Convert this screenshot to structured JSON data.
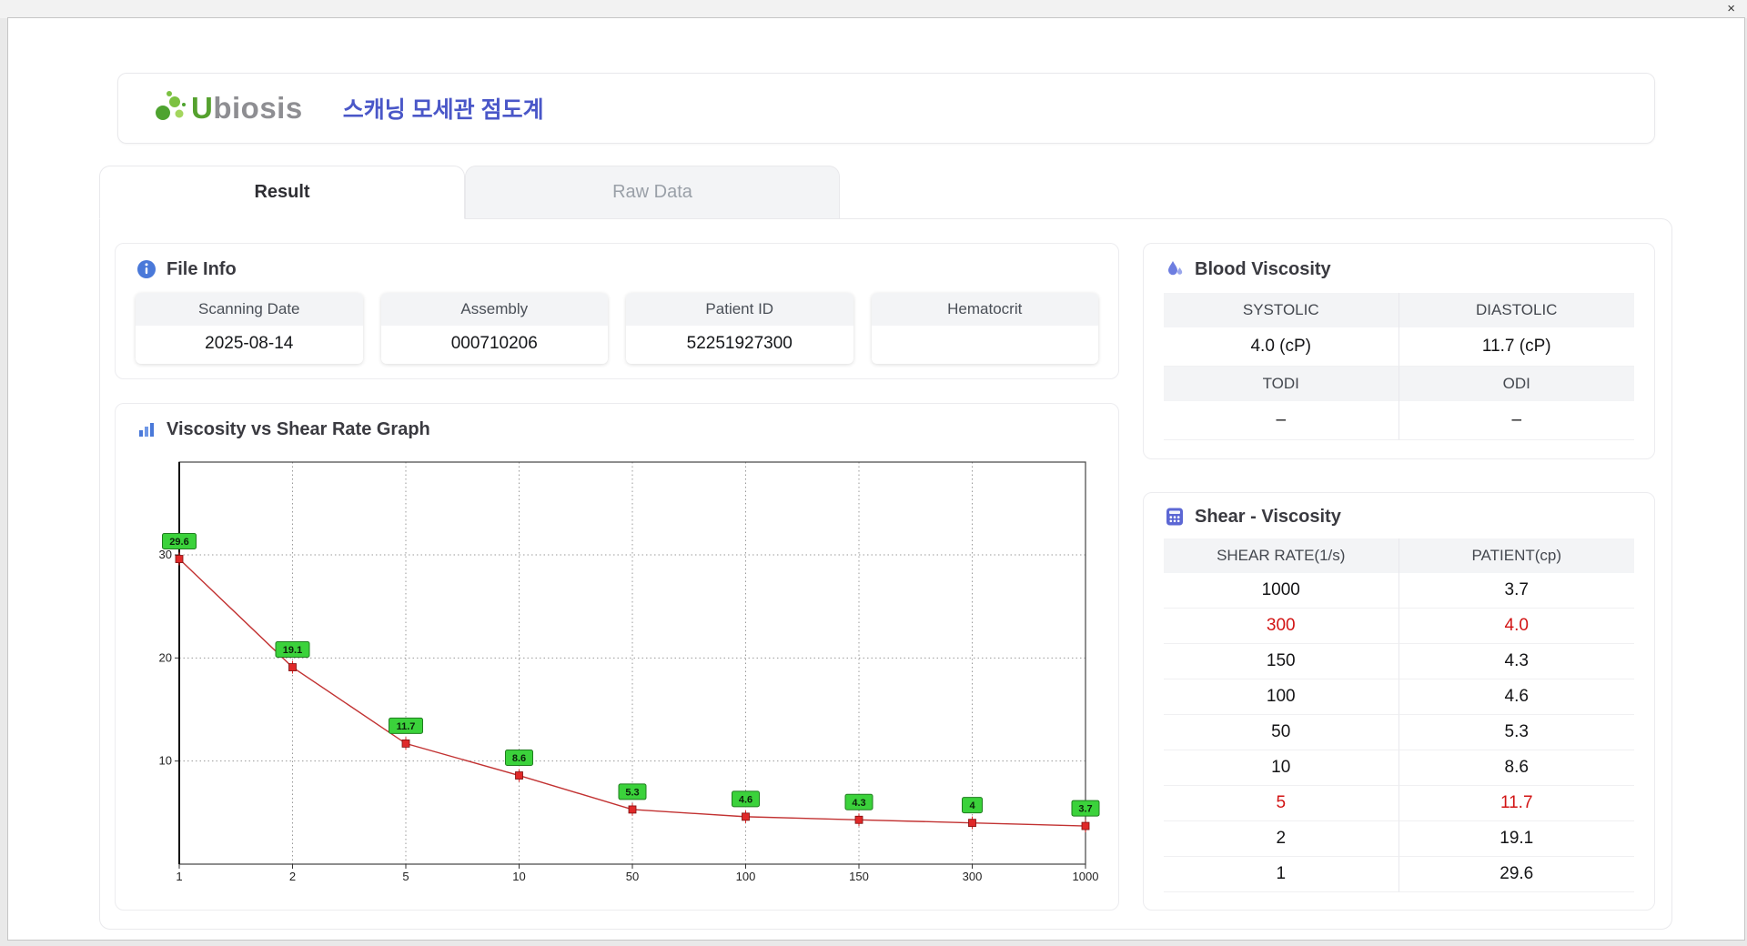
{
  "window": {
    "close_icon": "×"
  },
  "header": {
    "logo_u": "U",
    "logo_rest": "biosis",
    "title": "스캐닝 모세관 점도계"
  },
  "tabs": [
    {
      "label": "Result",
      "active": true
    },
    {
      "label": "Raw Data",
      "active": false
    }
  ],
  "icons": {
    "file_info": "info-icon",
    "graph": "bar-chart-icon",
    "blood_viscosity": "droplet-icon",
    "shear_viscosity": "calculator-icon",
    "close": "close-icon",
    "logo": "ubiosis-dots-icon"
  },
  "file_info": {
    "title": "File Info",
    "fields": [
      {
        "label": "Scanning Date",
        "value": "2025-08-14"
      },
      {
        "label": "Assembly",
        "value": "000710206"
      },
      {
        "label": "Patient ID",
        "value": "52251927300"
      },
      {
        "label": "Hematocrit",
        "value": ""
      }
    ]
  },
  "chart_data": {
    "type": "line",
    "title": "Viscosity vs Shear Rate Graph",
    "x": [
      1,
      2,
      5,
      10,
      50,
      100,
      150,
      300,
      1000
    ],
    "values": [
      29.6,
      19.1,
      11.7,
      8.6,
      5.3,
      4.6,
      4.3,
      4,
      3.7
    ],
    "labels": [
      "29.6",
      "19.1",
      "11.7",
      "8.6",
      "5.3",
      "4.6",
      "4.3",
      "4",
      "3.7"
    ],
    "xlabel": "",
    "ylabel": "",
    "x_spacing": "even",
    "ylim": [
      0,
      39
    ],
    "yticks": [
      10,
      20,
      30
    ],
    "grid": true,
    "line_color": "#c23232",
    "marker_color": "#e02828",
    "label_bg": "#3bd23b",
    "label_border": "#1f7d1f"
  },
  "blood_viscosity": {
    "title": "Blood Viscosity",
    "rows": [
      {
        "labels": [
          "SYSTOLIC",
          "DIASTOLIC"
        ],
        "values": [
          "4.0 (cP)",
          "11.7 (cP)"
        ]
      },
      {
        "labels": [
          "TODI",
          "ODI"
        ],
        "values": [
          "–",
          "–"
        ]
      }
    ]
  },
  "shear_viscosity": {
    "title": "Shear - Viscosity",
    "columns": [
      "SHEAR RATE(1/s)",
      "PATIENT(cp)"
    ],
    "rows": [
      {
        "shear": "1000",
        "patient": "3.7",
        "highlight": false
      },
      {
        "shear": "300",
        "patient": "4.0",
        "highlight": true
      },
      {
        "shear": "150",
        "patient": "4.3",
        "highlight": false
      },
      {
        "shear": "100",
        "patient": "4.6",
        "highlight": false
      },
      {
        "shear": "50",
        "patient": "5.3",
        "highlight": false
      },
      {
        "shear": "10",
        "patient": "8.6",
        "highlight": false
      },
      {
        "shear": "5",
        "patient": "11.7",
        "highlight": true
      },
      {
        "shear": "2",
        "patient": "19.1",
        "highlight": false
      },
      {
        "shear": "1",
        "patient": "29.6",
        "highlight": false
      }
    ]
  }
}
